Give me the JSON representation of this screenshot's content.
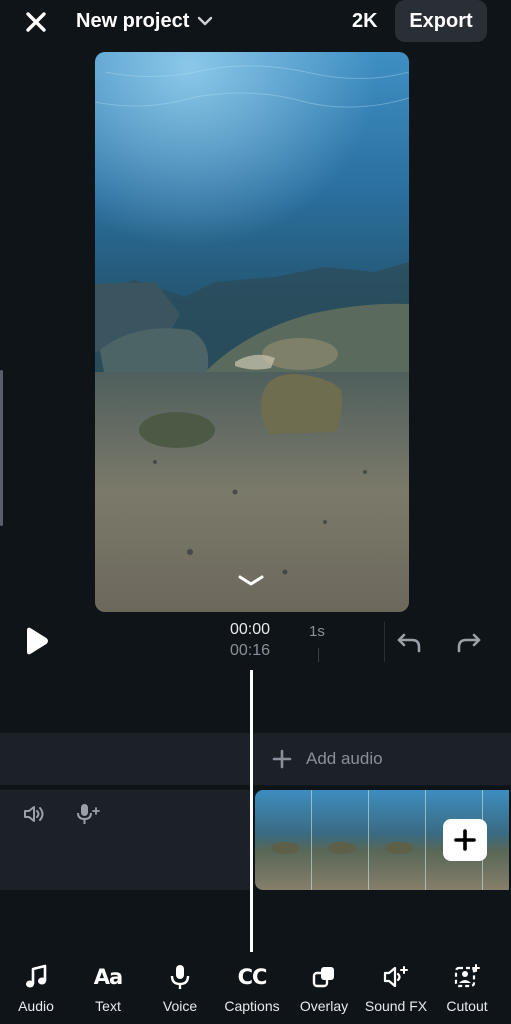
{
  "header": {
    "title": "New project",
    "resolution": "2K",
    "export_label": "Export"
  },
  "player": {
    "current_time": "00:00",
    "total_time": "00:16",
    "tick_label": "1s"
  },
  "timeline": {
    "add_audio_label": "Add audio"
  },
  "toolbar": {
    "items": [
      {
        "label": "Audio",
        "icon": "music-note-icon"
      },
      {
        "label": "Text",
        "icon_text": "Aa",
        "icon": "text-icon"
      },
      {
        "label": "Voice",
        "icon": "microphone-icon"
      },
      {
        "label": "Captions",
        "icon_text": "CC",
        "icon": "captions-icon"
      },
      {
        "label": "Overlay",
        "icon": "overlay-icon"
      },
      {
        "label": "Sound FX",
        "icon": "sound-fx-icon"
      },
      {
        "label": "Cutout",
        "icon": "cutout-icon"
      }
    ]
  },
  "colors": {
    "background": "#0f1419",
    "track": "#1c2127",
    "export_button": "#2a2f36"
  }
}
